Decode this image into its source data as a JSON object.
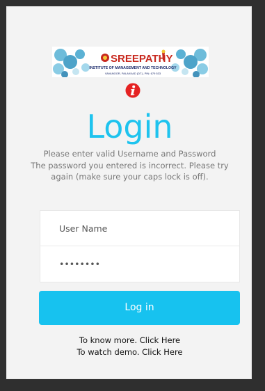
{
  "logo": {
    "name": "SREEPATHY",
    "subtitle": "INSTITUTE OF MANAGEMENT AND TECHNOLOGY",
    "address": "VAVANOOR, PALAKKAD (DT.), PIN: 679 533"
  },
  "login": {
    "title": "Login",
    "message_line1": "Please enter valid Username and Password",
    "message_line2": "The password you entered is incorrect. Please try again (make sure your caps lock is off).",
    "username_placeholder": "User Name",
    "password_value": "secret12",
    "button_label": "Log in"
  },
  "links": {
    "know_more": "To know more. Click Here",
    "watch_demo": "To watch demo. Click Here"
  },
  "colors": {
    "accent": "#1ec3ee",
    "button": "#17c2ef",
    "error_icon": "#e52222",
    "background": "#2f2f2f",
    "card": "#f3f3f3"
  }
}
